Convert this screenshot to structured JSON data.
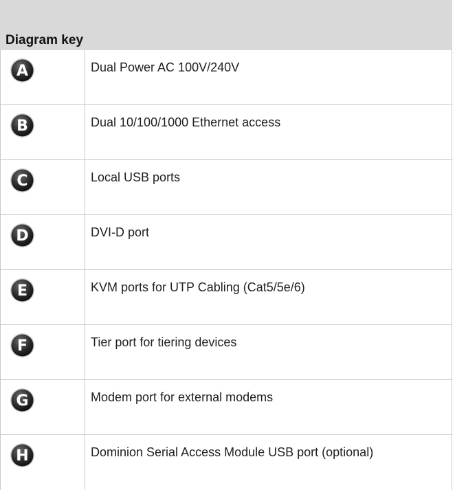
{
  "diagram_key": {
    "title": "Diagram key",
    "rows": [
      {
        "letter": "A",
        "icon": "letter-a-circle-icon",
        "description": "Dual Power AC 100V/240V"
      },
      {
        "letter": "B",
        "icon": "letter-b-circle-icon",
        "description": "Dual 10/100/1000 Ethernet access"
      },
      {
        "letter": "C",
        "icon": "letter-c-circle-icon",
        "description": "Local USB ports"
      },
      {
        "letter": "D",
        "icon": "letter-d-circle-icon",
        "description": "DVI-D port"
      },
      {
        "letter": "E",
        "icon": "letter-e-circle-icon",
        "description": "KVM ports for UTP Cabling (Cat5/5e/6)"
      },
      {
        "letter": "F",
        "icon": "letter-f-circle-icon",
        "description": "Tier port for tiering devices"
      },
      {
        "letter": "G",
        "icon": "letter-g-circle-icon",
        "description": "Modem port for external modems"
      },
      {
        "letter": "H",
        "icon": "letter-h-circle-icon",
        "description": "Dominion Serial Access Module USB port (optional)"
      }
    ]
  },
  "colors": {
    "header_background": "#d9d9d9",
    "grid_line": "#c8c8c8",
    "badge_fill": "#2b2b2b",
    "badge_letter": "#ffffff"
  }
}
